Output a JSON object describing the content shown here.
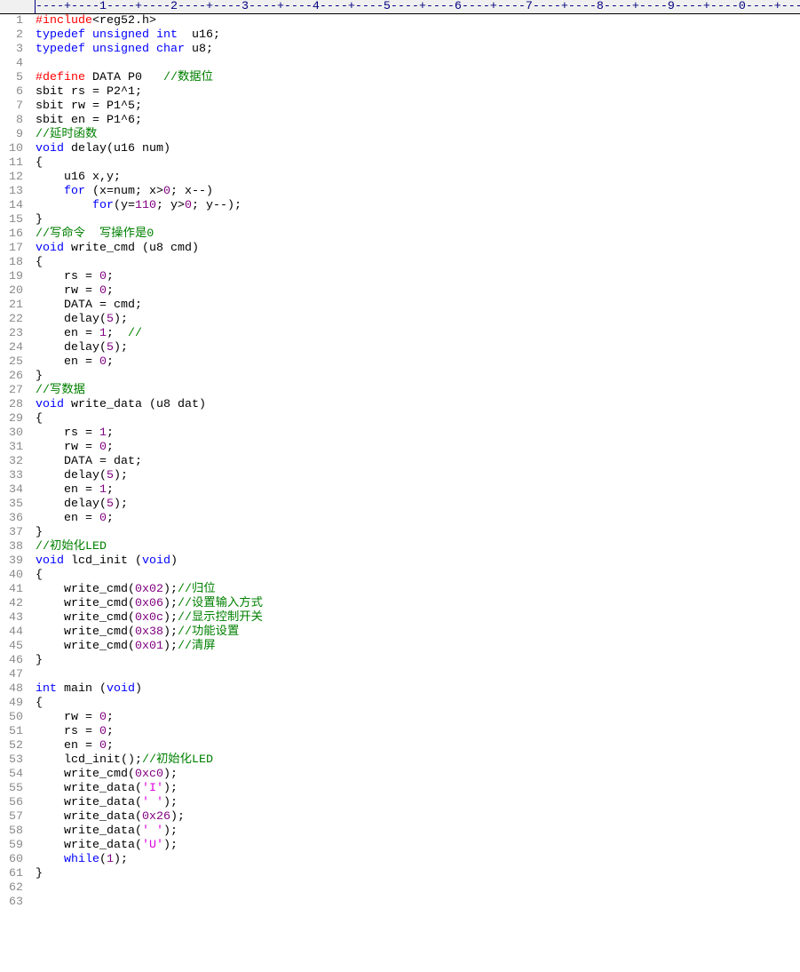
{
  "ruler": "----+----1----+----2----+----3----+----4----+----5----+----6----+----7----+----8----+----9----+----0----+---",
  "colors": {
    "keyword": "#0000ff",
    "preprocessor": "#ff0000",
    "comment": "#008000",
    "number": "#800080",
    "string": "#e000e0",
    "text": "#000000",
    "line_number": "#8a8a8a"
  },
  "lines": [
    [
      [
        "p",
        "#include"
      ],
      [
        "t",
        "<reg52.h>"
      ]
    ],
    [
      [
        "k",
        "typedef"
      ],
      [
        "t",
        " "
      ],
      [
        "k",
        "unsigned"
      ],
      [
        "t",
        " "
      ],
      [
        "k",
        "int"
      ],
      [
        "t",
        "  u16;"
      ]
    ],
    [
      [
        "k",
        "typedef"
      ],
      [
        "t",
        " "
      ],
      [
        "k",
        "unsigned"
      ],
      [
        "t",
        " "
      ],
      [
        "k",
        "char"
      ],
      [
        "t",
        " u8;"
      ]
    ],
    [],
    [
      [
        "p",
        "#define"
      ],
      [
        "t",
        " DATA P0   "
      ],
      [
        "c",
        "//数据位"
      ]
    ],
    [
      [
        "t",
        "sbit rs = P2^1;"
      ]
    ],
    [
      [
        "t",
        "sbit rw = P1^5;"
      ]
    ],
    [
      [
        "t",
        "sbit en = P1^6;"
      ]
    ],
    [
      [
        "c",
        "//延时函数"
      ]
    ],
    [
      [
        "k",
        "void"
      ],
      [
        "t",
        " delay(u16 num)"
      ]
    ],
    [
      [
        "t",
        "{"
      ]
    ],
    [
      [
        "t",
        "    u16 x,y;"
      ]
    ],
    [
      [
        "t",
        "    "
      ],
      [
        "k",
        "for"
      ],
      [
        "t",
        " (x=num; x>"
      ],
      [
        "n",
        "0"
      ],
      [
        "t",
        "; x--)"
      ]
    ],
    [
      [
        "t",
        "        "
      ],
      [
        "k",
        "for"
      ],
      [
        "t",
        "(y="
      ],
      [
        "n",
        "110"
      ],
      [
        "t",
        "; y>"
      ],
      [
        "n",
        "0"
      ],
      [
        "t",
        "; y--);"
      ]
    ],
    [
      [
        "t",
        "}"
      ]
    ],
    [
      [
        "c",
        "//写命令  写操作是0"
      ]
    ],
    [
      [
        "k",
        "void"
      ],
      [
        "t",
        " write_cmd (u8 cmd)"
      ]
    ],
    [
      [
        "t",
        "{"
      ]
    ],
    [
      [
        "t",
        "    rs = "
      ],
      [
        "n",
        "0"
      ],
      [
        "t",
        ";"
      ]
    ],
    [
      [
        "t",
        "    rw = "
      ],
      [
        "n",
        "0"
      ],
      [
        "t",
        ";"
      ]
    ],
    [
      [
        "t",
        "    DATA = cmd;"
      ]
    ],
    [
      [
        "t",
        "    delay("
      ],
      [
        "n",
        "5"
      ],
      [
        "t",
        ");"
      ]
    ],
    [
      [
        "t",
        "    en = "
      ],
      [
        "n",
        "1"
      ],
      [
        "t",
        ";  "
      ],
      [
        "c",
        "//"
      ]
    ],
    [
      [
        "t",
        "    delay("
      ],
      [
        "n",
        "5"
      ],
      [
        "t",
        ");"
      ]
    ],
    [
      [
        "t",
        "    en = "
      ],
      [
        "n",
        "0"
      ],
      [
        "t",
        ";"
      ]
    ],
    [
      [
        "t",
        "}"
      ]
    ],
    [
      [
        "c",
        "//写数据"
      ]
    ],
    [
      [
        "k",
        "void"
      ],
      [
        "t",
        " write_data (u8 dat)"
      ]
    ],
    [
      [
        "t",
        "{"
      ]
    ],
    [
      [
        "t",
        "    rs = "
      ],
      [
        "n",
        "1"
      ],
      [
        "t",
        ";"
      ]
    ],
    [
      [
        "t",
        "    rw = "
      ],
      [
        "n",
        "0"
      ],
      [
        "t",
        ";"
      ]
    ],
    [
      [
        "t",
        "    DATA = dat;"
      ]
    ],
    [
      [
        "t",
        "    delay("
      ],
      [
        "n",
        "5"
      ],
      [
        "t",
        ");"
      ]
    ],
    [
      [
        "t",
        "    en = "
      ],
      [
        "n",
        "1"
      ],
      [
        "t",
        ";"
      ]
    ],
    [
      [
        "t",
        "    delay("
      ],
      [
        "n",
        "5"
      ],
      [
        "t",
        ");"
      ]
    ],
    [
      [
        "t",
        "    en = "
      ],
      [
        "n",
        "0"
      ],
      [
        "t",
        ";"
      ]
    ],
    [
      [
        "t",
        "}"
      ]
    ],
    [
      [
        "c",
        "//初始化LED"
      ]
    ],
    [
      [
        "k",
        "void"
      ],
      [
        "t",
        " lcd_init ("
      ],
      [
        "k",
        "void"
      ],
      [
        "t",
        ")"
      ]
    ],
    [
      [
        "t",
        "{"
      ]
    ],
    [
      [
        "t",
        "    write_cmd("
      ],
      [
        "n",
        "0x02"
      ],
      [
        "t",
        ");"
      ],
      [
        "c",
        "//归位"
      ]
    ],
    [
      [
        "t",
        "    write_cmd("
      ],
      [
        "n",
        "0x06"
      ],
      [
        "t",
        ");"
      ],
      [
        "c",
        "//设置输入方式"
      ]
    ],
    [
      [
        "t",
        "    write_cmd("
      ],
      [
        "n",
        "0x0c"
      ],
      [
        "t",
        ");"
      ],
      [
        "c",
        "//显示控制开关"
      ]
    ],
    [
      [
        "t",
        "    write_cmd("
      ],
      [
        "n",
        "0x38"
      ],
      [
        "t",
        ");"
      ],
      [
        "c",
        "//功能设置"
      ]
    ],
    [
      [
        "t",
        "    write_cmd("
      ],
      [
        "n",
        "0x01"
      ],
      [
        "t",
        ");"
      ],
      [
        "c",
        "//清屏"
      ]
    ],
    [
      [
        "t",
        "}"
      ]
    ],
    [],
    [
      [
        "k",
        "int"
      ],
      [
        "t",
        " main ("
      ],
      [
        "k",
        "void"
      ],
      [
        "t",
        ")"
      ]
    ],
    [
      [
        "t",
        "{"
      ]
    ],
    [
      [
        "t",
        "    rw = "
      ],
      [
        "n",
        "0"
      ],
      [
        "t",
        ";"
      ]
    ],
    [
      [
        "t",
        "    rs = "
      ],
      [
        "n",
        "0"
      ],
      [
        "t",
        ";"
      ]
    ],
    [
      [
        "t",
        "    en = "
      ],
      [
        "n",
        "0"
      ],
      [
        "t",
        ";"
      ]
    ],
    [
      [
        "t",
        "    lcd_init();"
      ],
      [
        "c",
        "//初始化LED"
      ]
    ],
    [
      [
        "t",
        "    write_cmd("
      ],
      [
        "n",
        "0xc0"
      ],
      [
        "t",
        ");"
      ]
    ],
    [
      [
        "t",
        "    write_data("
      ],
      [
        "s",
        "'I'"
      ],
      [
        "t",
        ");"
      ]
    ],
    [
      [
        "t",
        "    write_data("
      ],
      [
        "s",
        "' '"
      ],
      [
        "t",
        ");"
      ]
    ],
    [
      [
        "t",
        "    write_data("
      ],
      [
        "n",
        "0x26"
      ],
      [
        "t",
        ");"
      ]
    ],
    [
      [
        "t",
        "    write_data("
      ],
      [
        "s",
        "' '"
      ],
      [
        "t",
        ");"
      ]
    ],
    [
      [
        "t",
        "    write_data("
      ],
      [
        "s",
        "'U'"
      ],
      [
        "t",
        ");"
      ]
    ],
    [
      [
        "t",
        "    "
      ],
      [
        "k",
        "while"
      ],
      [
        "t",
        "("
      ],
      [
        "n",
        "1"
      ],
      [
        "t",
        ");"
      ]
    ],
    [
      [
        "t",
        "}"
      ]
    ],
    [],
    []
  ]
}
